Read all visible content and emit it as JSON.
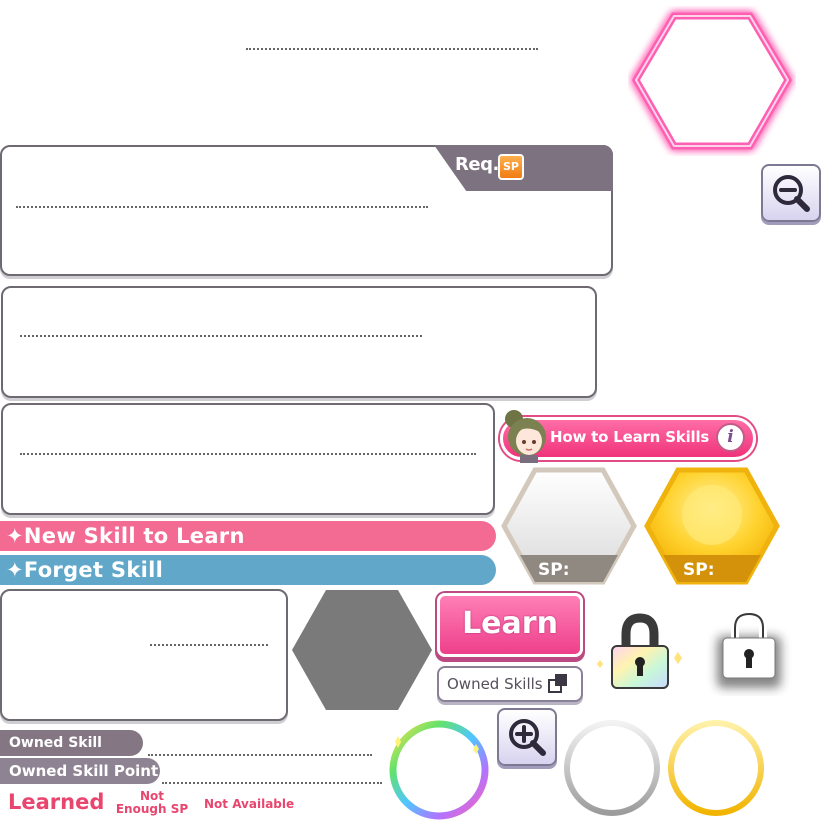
{
  "skill_panel": {
    "req_label": "Req.",
    "sp_badge": "SP"
  },
  "help": {
    "how_to_label": "How to Learn Skills",
    "info_glyph": "i"
  },
  "banners": {
    "new_skill": "New Skill to Learn",
    "forget_skill": "Forget Skill",
    "star_glyph": "✦"
  },
  "hex_slots": {
    "silver_sp": "SP:",
    "gold_sp": "SP:"
  },
  "buttons": {
    "learn": "Learn",
    "owned_skills": "Owned Skills"
  },
  "owned_points": {
    "label_1": "Owned Skill Point",
    "label_2": "Owned Skill Point"
  },
  "status": {
    "learned": "Learned",
    "not_enough_sp": "Not Enough SP",
    "not_available": "Not Available"
  },
  "colors": {
    "pink": "#f36a93",
    "blue": "#61a7c9",
    "panel_border": "#6f6a72",
    "gold": "#f7c21a",
    "neon_pink": "#ff5fb3"
  },
  "icons": {
    "zoom_out": "zoom-out-icon",
    "zoom_in": "zoom-in-icon",
    "lock": "lock-icon",
    "copy": "copy-icon",
    "info": "info-icon",
    "avatar": "avatar"
  }
}
